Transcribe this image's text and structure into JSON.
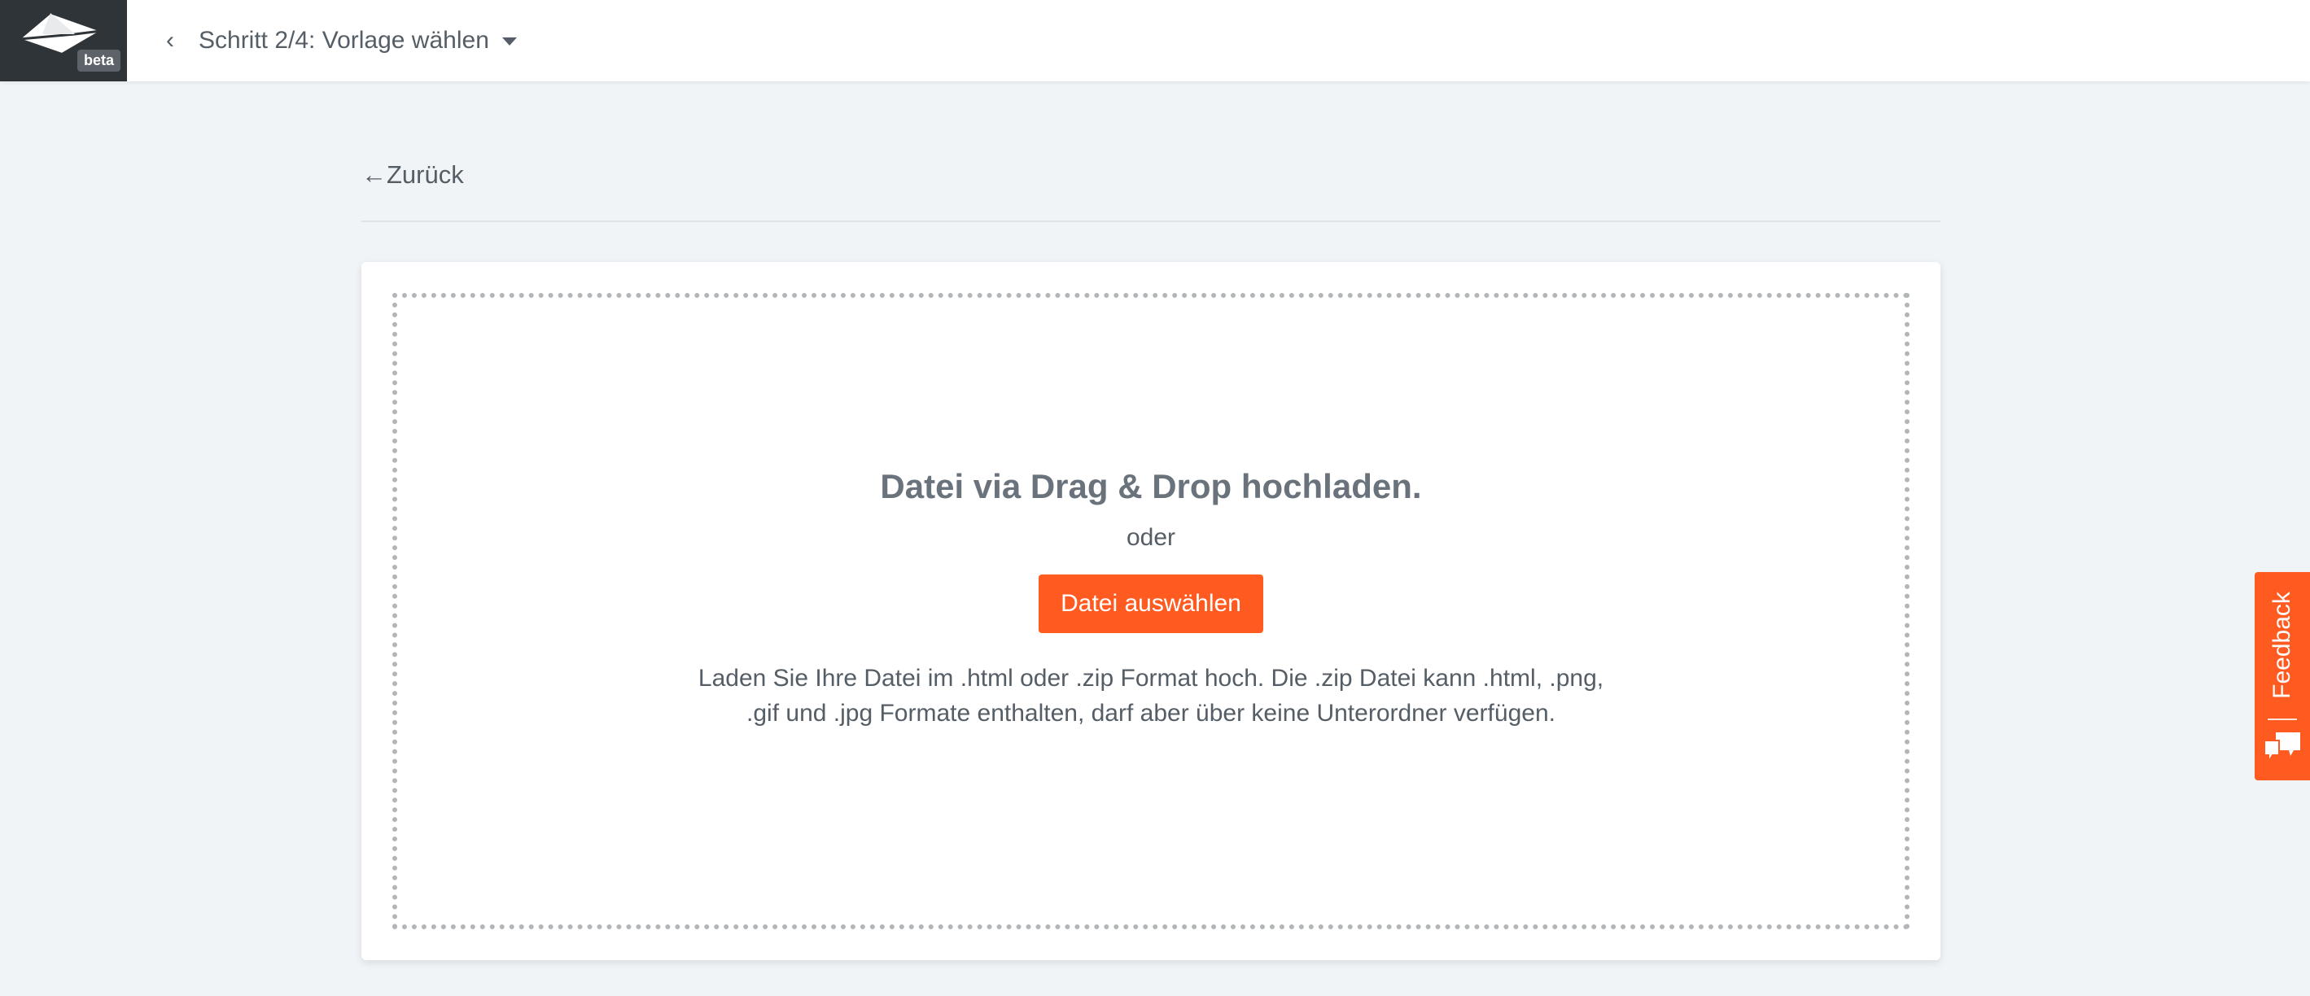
{
  "header": {
    "logo_badge": "beta",
    "back_icon": "chevron-left-icon",
    "step_title": "Schritt 2/4: Vorlage wählen",
    "dropdown_icon": "caret-down-icon"
  },
  "nav": {
    "back_arrow": "←",
    "back_label": "Zurück"
  },
  "upload": {
    "title": "Datei via Drag & Drop hochladen.",
    "or_text": "oder",
    "button_label": "Datei auswählen",
    "help_text": "Laden Sie Ihre Datei im .html oder .zip Format hoch. Die .zip Datei kann .html, .png, .gif und .jpg Formate enthalten, darf aber über keine Unterordner verfügen."
  },
  "feedback": {
    "label": "Feedback",
    "icon": "chat-bubbles-icon"
  },
  "colors": {
    "accent": "#ff5a1f",
    "logo_bg": "#2f3438",
    "page_bg": "#f0f4f7",
    "text": "#555e66"
  }
}
